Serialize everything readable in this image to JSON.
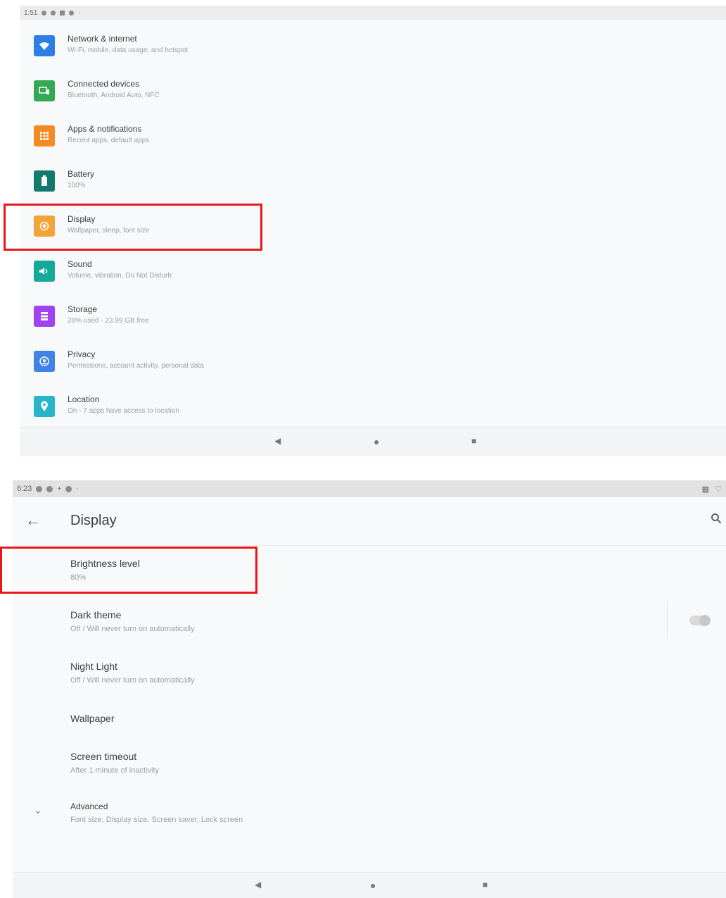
{
  "shot1": {
    "status_time": "1:51",
    "items": [
      {
        "title": "Network & internet",
        "subtitle": "Wi-Fi, mobile, data usage, and hotspot",
        "color": "#2f7ee6",
        "icon": "wifi-icon"
      },
      {
        "title": "Connected devices",
        "subtitle": "Bluetooth, Android Auto, NFC",
        "color": "#34a853",
        "icon": "devices-icon"
      },
      {
        "title": "Apps & notifications",
        "subtitle": "Recent apps, default apps",
        "color": "#f28b22",
        "icon": "apps-icon"
      },
      {
        "title": "Battery",
        "subtitle": "100%",
        "color": "#137a6e",
        "icon": "battery-icon"
      },
      {
        "title": "Display",
        "subtitle": "Wallpaper, sleep, font size",
        "color": "#f2a43a",
        "icon": "display-icon"
      },
      {
        "title": "Sound",
        "subtitle": "Volume, vibration, Do Not Disturb",
        "color": "#15a99a",
        "icon": "sound-icon"
      },
      {
        "title": "Storage",
        "subtitle": "28% used - 23.99 GB free",
        "color": "#a142f4",
        "icon": "storage-icon"
      },
      {
        "title": "Privacy",
        "subtitle": "Permissions, account activity, personal data",
        "color": "#3f82e8",
        "icon": "privacy-icon"
      },
      {
        "title": "Location",
        "subtitle": "On - 7 apps have access to location",
        "color": "#28b5c9",
        "icon": "location-icon"
      }
    ]
  },
  "shot2": {
    "status_time": "6:23",
    "title": "Display",
    "prefs": [
      {
        "title": "Brightness level",
        "subtitle": "80%"
      },
      {
        "title": "Dark theme",
        "subtitle": "Off / Will never turn on automatically"
      },
      {
        "title": "Night Light",
        "subtitle": "Off / Will never turn on automatically"
      },
      {
        "title": "Wallpaper",
        "subtitle": ""
      },
      {
        "title": "Screen timeout",
        "subtitle": "After 1 minute of inactivity"
      },
      {
        "title": "Advanced",
        "subtitle": "Font size, Display size, Screen saver, Lock screen"
      }
    ],
    "dark_theme_on": false
  },
  "highlight_color": "#e8191c"
}
